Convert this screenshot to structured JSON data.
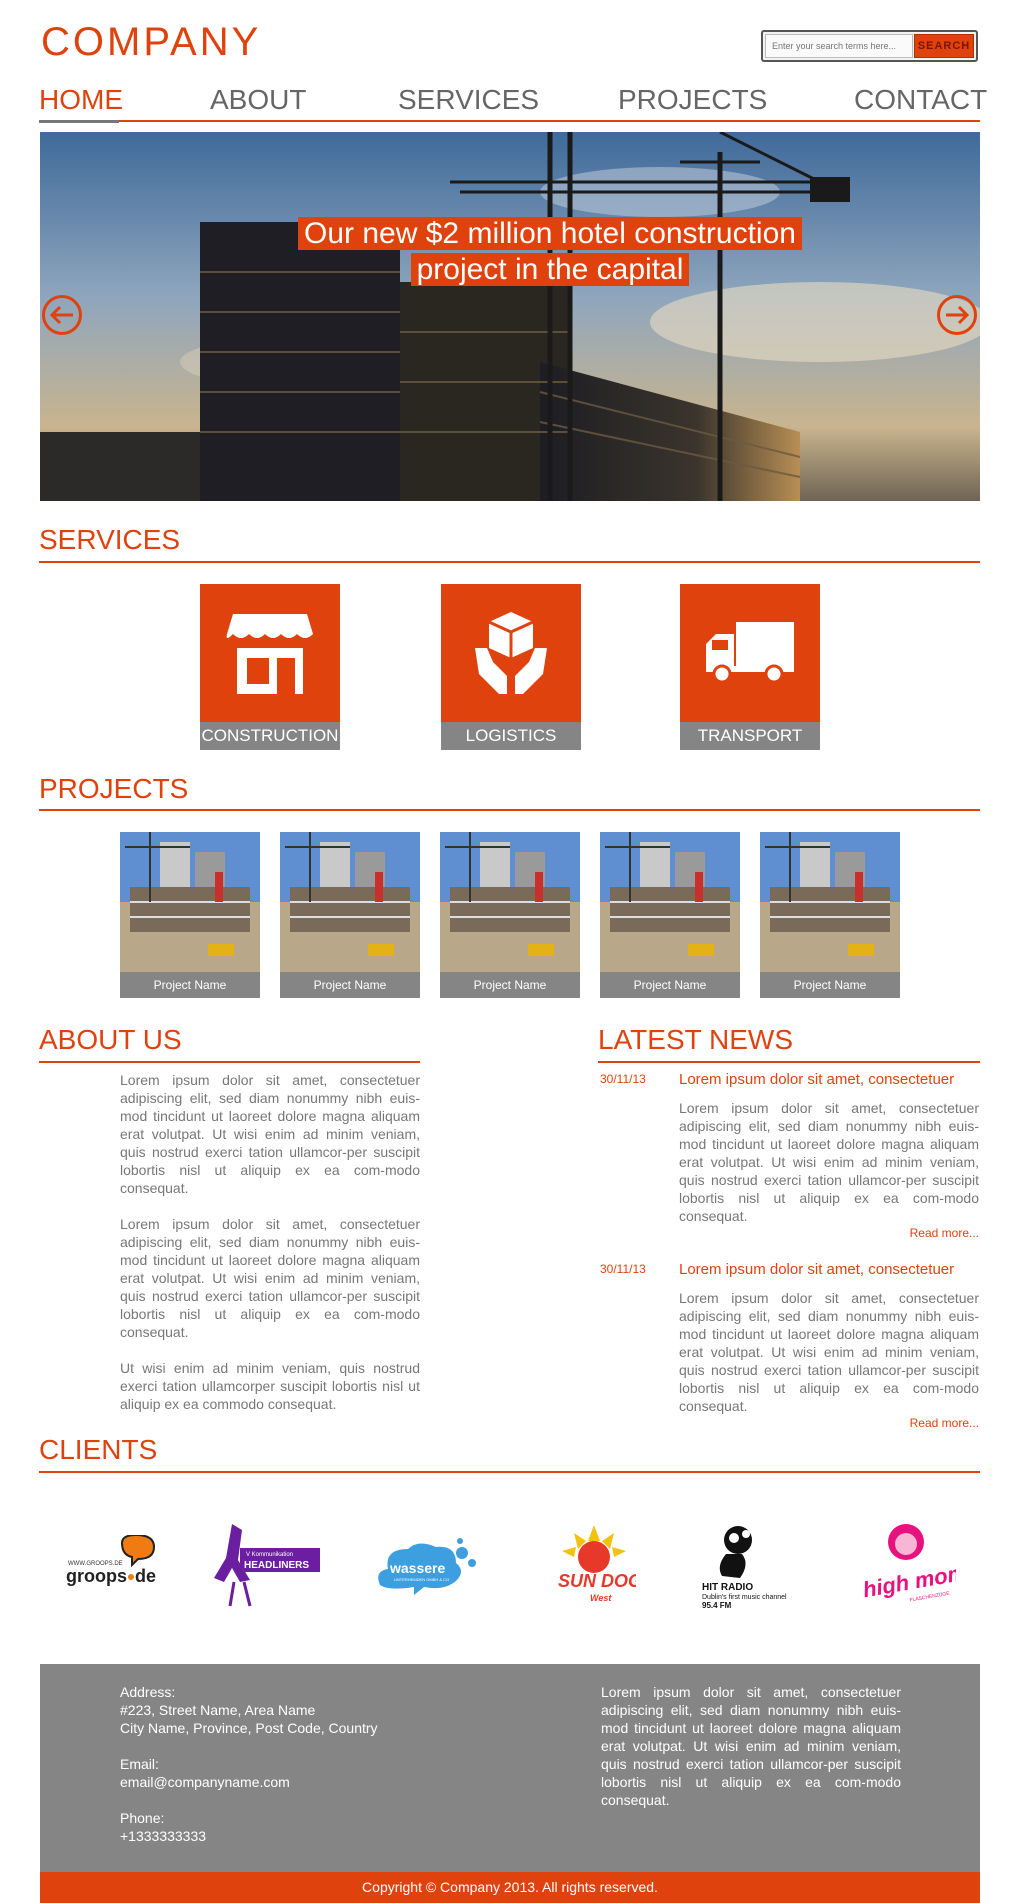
{
  "header": {
    "logo": "COMPANY",
    "search_placeholder": "Enter your search terms here...",
    "search_button": "SEARCH"
  },
  "nav": {
    "items": [
      "HOME",
      "ABOUT",
      "SERVICES",
      "PROJECTS",
      "CONTACT"
    ],
    "active": "HOME"
  },
  "hero": {
    "caption_line1": "Our new $2 million hotel construction",
    "caption_line2": "project in the capital",
    "prev_icon": "arrow-left-circle-icon",
    "next_icon": "arrow-right-circle-icon"
  },
  "services": {
    "title": "SERVICES",
    "items": [
      {
        "label": "CONSTRUCTION",
        "icon": "storefront-icon"
      },
      {
        "label": "LOGISTICS",
        "icon": "package-hands-icon"
      },
      {
        "label": "TRANSPORT",
        "icon": "truck-icon"
      }
    ]
  },
  "projects": {
    "title": "PROJECTS",
    "items": [
      "Project Name",
      "Project Name",
      "Project Name",
      "Project Name",
      "Project Name"
    ]
  },
  "about": {
    "title": "ABOUT US",
    "p1": "Lorem ipsum dolor sit amet, consectetuer adipiscing elit, sed diam nonummy nibh euis-mod tincidunt ut laoreet dolore magna aliquam erat volutpat. Ut wisi enim ad minim veniam, quis nostrud exerci tation ullamcor-per suscipit lobortis nisl ut aliquip ex ea com-modo consequat.",
    "p2": "Lorem ipsum dolor sit amet, consectetuer adipiscing elit, sed diam nonummy nibh euis-mod tincidunt ut laoreet dolore magna aliquam erat volutpat. Ut wisi enim ad minim veniam, quis nostrud exerci tation ullamcor-per suscipit lobortis nisl ut aliquip ex ea com-modo consequat.",
    "p3": "Ut wisi enim ad minim veniam, quis nostrud exerci tation ullamcorper suscipit lobortis nisl ut aliquip ex ea commodo consequat."
  },
  "news": {
    "title": "LATEST NEWS",
    "items": [
      {
        "date": "30/11/13",
        "headline": "Lorem ipsum dolor sit amet, consectetuer",
        "body": "Lorem ipsum dolor sit amet, consectetuer adipiscing elit, sed diam nonummy nibh euis-mod tincidunt ut laoreet dolore magna aliquam erat volutpat. Ut wisi enim ad minim veniam, quis nostrud exerci tation ullamcor-per suscipit lobortis nisl ut aliquip ex ea com-modo consequat.",
        "more": "Read more..."
      },
      {
        "date": "30/11/13",
        "headline": "Lorem ipsum dolor sit amet, consectetuer",
        "body": "Lorem ipsum dolor sit amet, consectetuer adipiscing elit, sed diam nonummy nibh euis-mod tincidunt ut laoreet dolore magna aliquam erat volutpat. Ut wisi enim ad minim veniam, quis nostrud exerci tation ullamcor-per suscipit lobortis nisl ut aliquip ex ea com-modo consequat.",
        "more": "Read more..."
      }
    ]
  },
  "clients": {
    "title": "CLIENTS",
    "logos": [
      "groops-logo",
      "headliners-logo",
      "wassere-logo",
      "sundog-logo",
      "hit-radio-logo",
      "high-mom-logo"
    ]
  },
  "footer": {
    "address_label": "Address:",
    "address_line1": "#223, Street Name, Area Name",
    "address_line2": "City Name, Province, Post Code, Country",
    "email_label": "Email:",
    "email": "email@companyname.com",
    "phone_label": "Phone:",
    "phone": "+1333333333",
    "blurb": "Lorem ipsum dolor sit amet, consectetuer adipiscing elit, sed diam nonummy nibh euis-mod tincidunt ut laoreet dolore magna aliquam erat volutpat. Ut wisi enim ad minim veniam, quis nostrud exerci tation ullamcor-per suscipit lobortis nisl ut aliquip ex ea com-modo consequat.",
    "copyright": "Copyright © Company 2013. All rights reserved."
  },
  "colors": {
    "accent": "#e0420e",
    "gray": "#858585"
  }
}
